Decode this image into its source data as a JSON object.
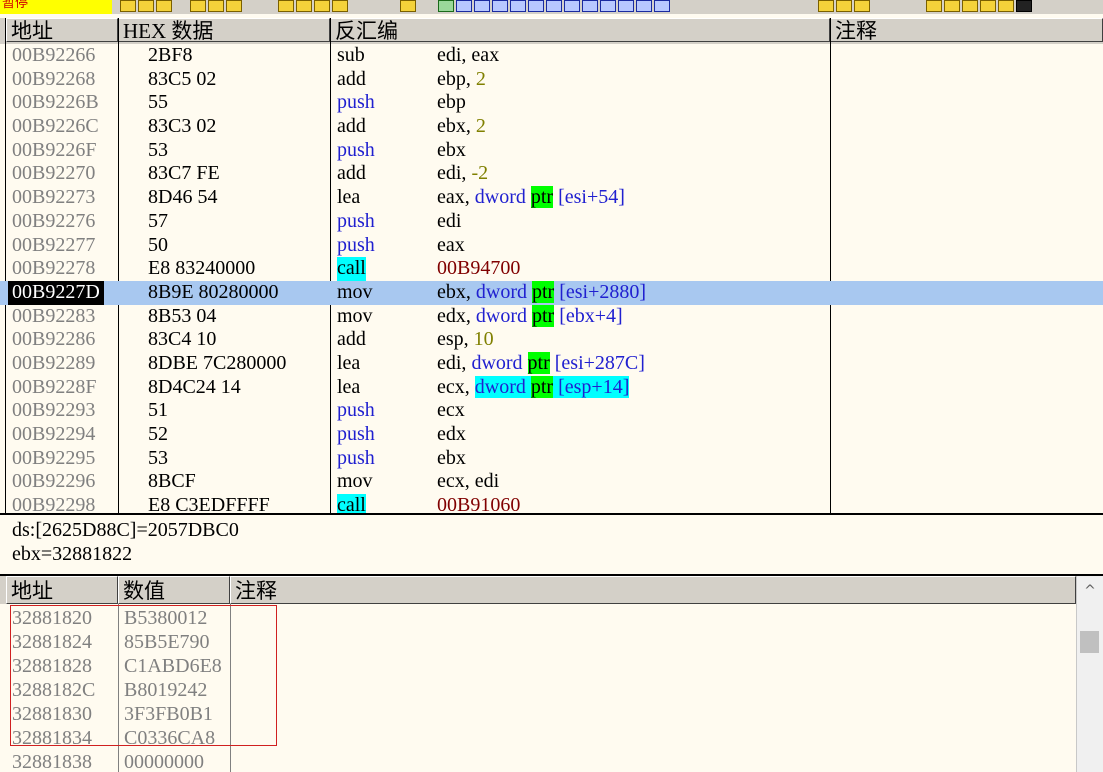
{
  "toolbar": {
    "status_text": "暂停",
    "icons": [
      "open-icon",
      "rewind-icon",
      "close-icon",
      "play-icon",
      "pause-icon",
      "step-into-icon",
      "step-over-icon",
      "trace-into-icon",
      "trace-over-icon",
      "execute-till-return-icon",
      "goto-icon",
      "log-window-icon",
      "executable-modules-icon",
      "memory-map-icon",
      "threads-icon",
      "cpu-icon",
      "patches-icon",
      "call-stack-icon",
      "breakpoints-icon",
      "references-icon",
      "run-trace-icon",
      "source-icon",
      "options-icon",
      "list-icon",
      "help-icon",
      "plugin-icon"
    ]
  },
  "disasm": {
    "headers": {
      "address": "地址",
      "hex": "HEX 数据",
      "disasm": "反汇编",
      "comment": "注释"
    },
    "rows": [
      {
        "addr": "00B92266",
        "hex": "2BF8",
        "mn": "sub",
        "mnk": "plain",
        "ops": [
          [
            "r",
            "edi, eax"
          ]
        ]
      },
      {
        "addr": "00B92268",
        "hex": "83C5 02",
        "mn": "add",
        "mnk": "plain",
        "ops": [
          [
            "r",
            "ebp, "
          ],
          [
            "n",
            "2"
          ]
        ]
      },
      {
        "addr": "00B9226B",
        "hex": "55",
        "mn": "push",
        "mnk": "push",
        "ops": [
          [
            "r",
            "ebp"
          ]
        ]
      },
      {
        "addr": "00B9226C",
        "hex": "83C3 02",
        "mn": "add",
        "mnk": "plain",
        "ops": [
          [
            "r",
            "ebx, "
          ],
          [
            "n",
            "2"
          ]
        ]
      },
      {
        "addr": "00B9226F",
        "hex": "53",
        "mn": "push",
        "mnk": "push",
        "ops": [
          [
            "r",
            "ebx"
          ]
        ]
      },
      {
        "addr": "00B92270",
        "hex": "83C7 FE",
        "mn": "add",
        "mnk": "plain",
        "ops": [
          [
            "r",
            "edi, "
          ],
          [
            "n",
            "-2"
          ]
        ]
      },
      {
        "addr": "00B92273",
        "hex": "8D46 54",
        "mn": "lea",
        "mnk": "plain",
        "ops": [
          [
            "r",
            "eax, "
          ],
          [
            "k",
            "dword "
          ],
          [
            "p",
            "ptr"
          ],
          [
            "k",
            " [esi+54]"
          ]
        ]
      },
      {
        "addr": "00B92276",
        "hex": "57",
        "mn": "push",
        "mnk": "push",
        "ops": [
          [
            "r",
            "edi"
          ]
        ]
      },
      {
        "addr": "00B92277",
        "hex": "50",
        "mn": "push",
        "mnk": "push",
        "ops": [
          [
            "r",
            "eax"
          ]
        ]
      },
      {
        "addr": "00B92278",
        "hex": "E8 83240000",
        "mn": "call",
        "mnk": "call",
        "ops": [
          [
            "t",
            "00B94700"
          ]
        ]
      },
      {
        "addr": "00B9227D",
        "hex": "8B9E 80280000",
        "mn": "mov",
        "mnk": "plain",
        "sel": true,
        "ops": [
          [
            "r",
            "ebx, "
          ],
          [
            "k",
            "dword "
          ],
          [
            "p",
            "ptr"
          ],
          [
            "k",
            " [esi+2880]"
          ]
        ]
      },
      {
        "addr": "00B92283",
        "hex": "8B53 04",
        "mn": "mov",
        "mnk": "plain",
        "ops": [
          [
            "r",
            "edx, "
          ],
          [
            "k",
            "dword "
          ],
          [
            "p",
            "ptr"
          ],
          [
            "k",
            " [ebx+4]"
          ]
        ]
      },
      {
        "addr": "00B92286",
        "hex": "83C4 10",
        "mn": "add",
        "mnk": "plain",
        "ops": [
          [
            "r",
            "esp, "
          ],
          [
            "n",
            "10"
          ]
        ]
      },
      {
        "addr": "00B92289",
        "hex": "8DBE 7C280000",
        "mn": "lea",
        "mnk": "plain",
        "ops": [
          [
            "r",
            "edi, "
          ],
          [
            "k",
            "dword "
          ],
          [
            "p",
            "ptr"
          ],
          [
            "k",
            " [esi+287C]"
          ]
        ]
      },
      {
        "addr": "00B9228F",
        "hex": "8D4C24 14",
        "mn": "lea",
        "mnk": "plain",
        "ops": [
          [
            "r",
            "ecx, "
          ],
          [
            "kh",
            "dword "
          ],
          [
            "p",
            "ptr"
          ],
          [
            "kh",
            " [esp+14]"
          ]
        ]
      },
      {
        "addr": "00B92293",
        "hex": "51",
        "mn": "push",
        "mnk": "push",
        "ops": [
          [
            "r",
            "ecx"
          ]
        ]
      },
      {
        "addr": "00B92294",
        "hex": "52",
        "mn": "push",
        "mnk": "push",
        "ops": [
          [
            "r",
            "edx"
          ]
        ]
      },
      {
        "addr": "00B92295",
        "hex": "53",
        "mn": "push",
        "mnk": "push",
        "ops": [
          [
            "r",
            "ebx"
          ]
        ]
      },
      {
        "addr": "00B92296",
        "hex": "8BCF",
        "mn": "mov",
        "mnk": "plain",
        "ops": [
          [
            "r",
            "ecx, edi"
          ]
        ]
      },
      {
        "addr": "00B92298",
        "hex": "E8 C3EDFFFF",
        "mn": "call",
        "mnk": "call",
        "ops": [
          [
            "t",
            "00B91060"
          ]
        ]
      }
    ]
  },
  "info": {
    "line1": "ds:[2625D88C]=2057DBC0",
    "line2": "ebx=32881822"
  },
  "dump": {
    "headers": {
      "address": "地址",
      "value": "数值",
      "comment": "注释"
    },
    "rows": [
      {
        "addr": "32881820",
        "val": "B5380012"
      },
      {
        "addr": "32881824",
        "val": "85B5E790"
      },
      {
        "addr": "32881828",
        "val": "C1ABD6E8"
      },
      {
        "addr": "3288182C",
        "val": "B8019242"
      },
      {
        "addr": "32881830",
        "val": "3F3FB0B1"
      },
      {
        "addr": "32881834",
        "val": "C0336CA8"
      },
      {
        "addr": "32881838",
        "val": "00000000"
      }
    ],
    "scroll_up_glyph": "^"
  },
  "colors": {
    "selected_row": "#a8c8f0",
    "ptr_highlight": "#00ff00",
    "call_highlight": "#00ffff",
    "push_mnemonic": "#2020d0",
    "constant": "#808000",
    "call_target": "#800000",
    "dump_box": "#d02020"
  }
}
